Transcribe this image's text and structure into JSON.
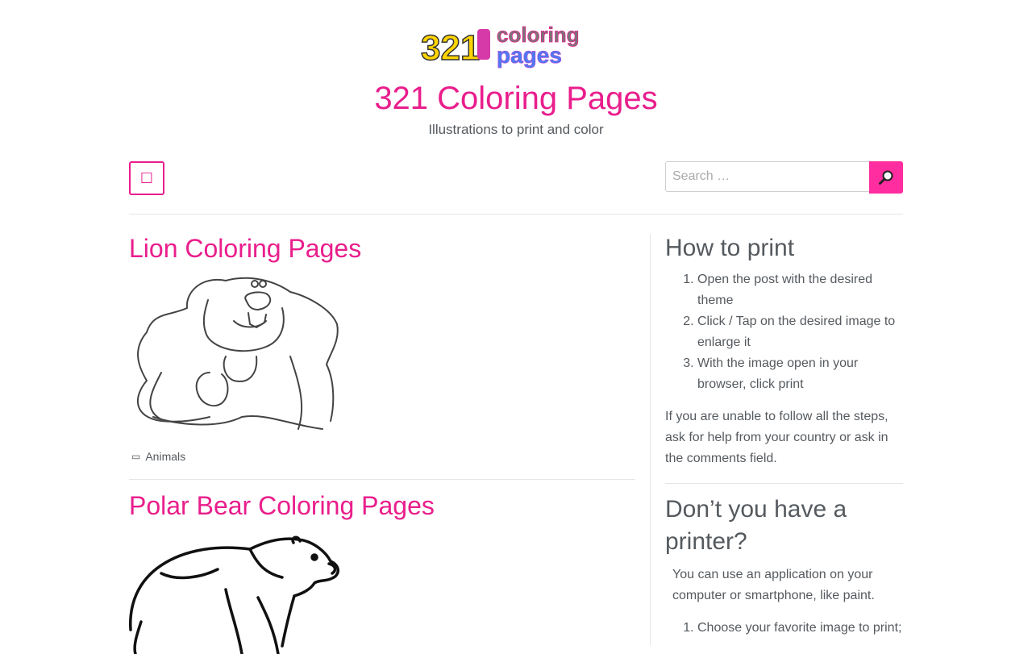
{
  "site": {
    "logo_text_1": "321",
    "logo_text_2": "coloring",
    "logo_text_3": "pages",
    "title": "321 Coloring Pages",
    "tagline": "Illustrations to print and color"
  },
  "nav": {
    "menu_icon": "menu-icon",
    "search_placeholder": "Search …",
    "search_icon": "search-icon"
  },
  "posts": [
    {
      "title": "Lion Coloring Pages",
      "category": "Animals"
    },
    {
      "title": "Polar Bear Coloring Pages"
    }
  ],
  "sidebar": {
    "how_to_print": {
      "title": "How to print",
      "steps": [
        "Open the post with the desired theme",
        "Click / Tap on the desired image to enlarge it",
        "With the image open in your browser, click print"
      ],
      "note": "If you are unable to follow all the steps, ask for help from your country or ask in the comments field."
    },
    "no_printer": {
      "title": "Don’t you have a printer?",
      "text": "You can use an application on your computer or smartphone, like paint.",
      "steps": [
        "Choose your favorite image to print;"
      ]
    }
  },
  "colors": {
    "accent": "#e91e8c",
    "button": "#ff2d9f",
    "text": "#555a5f"
  }
}
